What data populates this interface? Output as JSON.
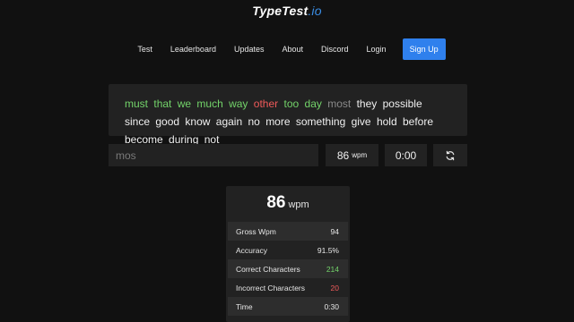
{
  "logo": {
    "name": "TypeTest",
    "tld": ".io"
  },
  "nav": {
    "items": [
      "Test",
      "Leaderboard",
      "Updates",
      "About",
      "Discord",
      "Login"
    ],
    "signup": "Sign Up"
  },
  "words": [
    {
      "text": "must",
      "state": "correct"
    },
    {
      "text": "that",
      "state": "correct"
    },
    {
      "text": "we",
      "state": "correct"
    },
    {
      "text": "much",
      "state": "correct"
    },
    {
      "text": "way",
      "state": "correct"
    },
    {
      "text": "other",
      "state": "incorrect"
    },
    {
      "text": "too",
      "state": "correct"
    },
    {
      "text": "day",
      "state": "correct"
    },
    {
      "text": "most",
      "state": "current"
    },
    {
      "text": "they",
      "state": "pending"
    },
    {
      "text": "possible",
      "state": "pending"
    },
    {
      "text": "since",
      "state": "pending"
    },
    {
      "text": "good",
      "state": "pending"
    },
    {
      "text": "know",
      "state": "pending"
    },
    {
      "text": "again",
      "state": "pending"
    },
    {
      "text": "no",
      "state": "pending"
    },
    {
      "text": "more",
      "state": "pending"
    },
    {
      "text": "something",
      "state": "pending"
    },
    {
      "text": "give",
      "state": "pending"
    },
    {
      "text": "hold",
      "state": "pending"
    },
    {
      "text": "before",
      "state": "pending"
    },
    {
      "text": "become",
      "state": "pending"
    },
    {
      "text": "during",
      "state": "pending"
    },
    {
      "text": "not",
      "state": "pending"
    }
  ],
  "input": {
    "value": "mos"
  },
  "live": {
    "wpm": "86",
    "wpm_unit": "wpm",
    "timer": "0:00"
  },
  "reset": {
    "icon": "refresh-icon"
  },
  "results": {
    "wpm": "86",
    "wpm_unit": "wpm",
    "stats": [
      {
        "label": "Gross Wpm",
        "value": "94",
        "color": ""
      },
      {
        "label": "Accuracy",
        "value": "91.5%",
        "color": ""
      },
      {
        "label": "Correct Characters",
        "value": "214",
        "color": "green"
      },
      {
        "label": "Incorrect Characters",
        "value": "20",
        "color": "red"
      },
      {
        "label": "Time",
        "value": "0:30",
        "color": ""
      }
    ]
  },
  "colors": {
    "accent": "#2f80ed",
    "correct": "#73d36a",
    "incorrect": "#ef5a5a",
    "background": "#111111",
    "panel": "#222222"
  }
}
